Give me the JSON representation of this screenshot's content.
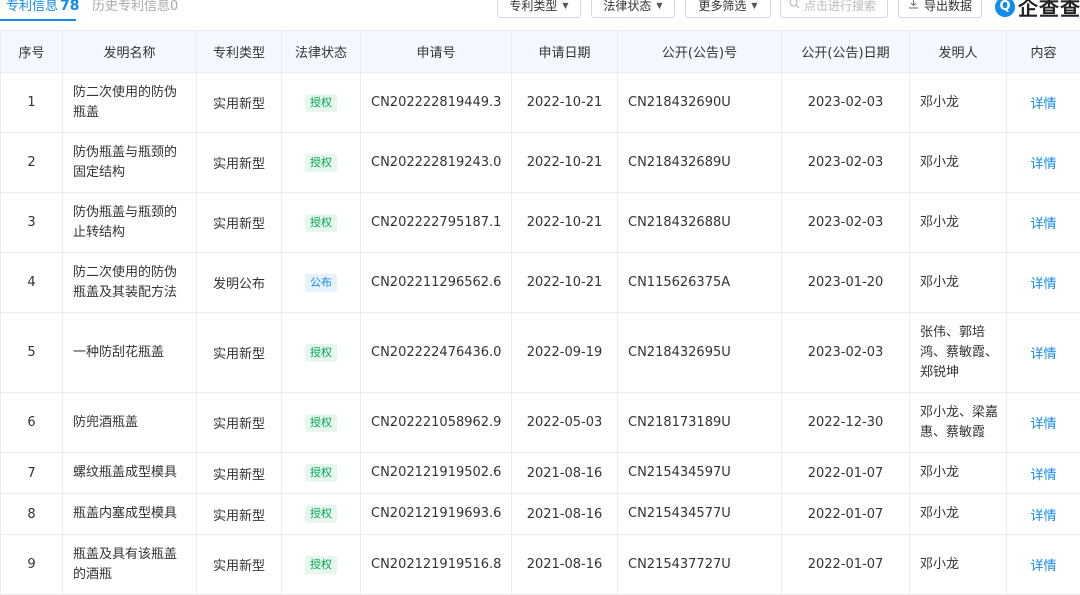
{
  "tabs": {
    "active_label": "专利信息",
    "active_count": "78",
    "inactive_label": "历史专利信息",
    "inactive_count": "0"
  },
  "filters": {
    "patent_type": "专利类型",
    "legal_status": "法律状态",
    "more_filters": "更多筛选",
    "search_placeholder": "点击进行搜索",
    "export": "导出数据"
  },
  "brand": {
    "mark": "Q",
    "name": "企查查"
  },
  "colors": {
    "accent": "#128bed",
    "granted": "#00a854",
    "header_bg": "#f2f8fe"
  },
  "table": {
    "headers": [
      "序号",
      "发明名称",
      "专利类型",
      "法律状态",
      "申请号",
      "申请日期",
      "公开(公告)号",
      "公开(公告)日期",
      "发明人",
      "内容"
    ],
    "rows": [
      {
        "no": "1",
        "name": "防二次使用的防伪瓶盖",
        "type": "实用新型",
        "status": "授权",
        "status_kind": "granted",
        "app_no": "CN202222819449.3",
        "app_date": "2022-10-21",
        "pub_no": "CN218432690U",
        "pub_date": "2023-02-03",
        "inventor": "邓小龙",
        "action": "详情"
      },
      {
        "no": "2",
        "name": "防伪瓶盖与瓶颈的固定结构",
        "type": "实用新型",
        "status": "授权",
        "status_kind": "granted",
        "app_no": "CN202222819243.0",
        "app_date": "2022-10-21",
        "pub_no": "CN218432689U",
        "pub_date": "2023-02-03",
        "inventor": "邓小龙",
        "action": "详情"
      },
      {
        "no": "3",
        "name": "防伪瓶盖与瓶颈的止转结构",
        "type": "实用新型",
        "status": "授权",
        "status_kind": "granted",
        "app_no": "CN202222795187.1",
        "app_date": "2022-10-21",
        "pub_no": "CN218432688U",
        "pub_date": "2023-02-03",
        "inventor": "邓小龙",
        "action": "详情"
      },
      {
        "no": "4",
        "name": "防二次使用的防伪瓶盖及其装配方法",
        "type": "发明公布",
        "status": "公布",
        "status_kind": "published",
        "app_no": "CN202211296562.6",
        "app_date": "2022-10-21",
        "pub_no": "CN115626375A",
        "pub_date": "2023-01-20",
        "inventor": "邓小龙",
        "action": "详情"
      },
      {
        "no": "5",
        "name": "一种防刮花瓶盖",
        "type": "实用新型",
        "status": "授权",
        "status_kind": "granted",
        "app_no": "CN202222476436.0",
        "app_date": "2022-09-19",
        "pub_no": "CN218432695U",
        "pub_date": "2023-02-03",
        "inventor": "张伟、郭培鸿、蔡敏霞、郑锐坤",
        "action": "详情"
      },
      {
        "no": "6",
        "name": "防兜酒瓶盖",
        "type": "实用新型",
        "status": "授权",
        "status_kind": "granted",
        "app_no": "CN202221058962.9",
        "app_date": "2022-05-03",
        "pub_no": "CN218173189U",
        "pub_date": "2022-12-30",
        "inventor": "邓小龙、梁嘉惠、蔡敏霞",
        "action": "详情"
      },
      {
        "no": "7",
        "name": "螺纹瓶盖成型模具",
        "type": "实用新型",
        "status": "授权",
        "status_kind": "granted",
        "app_no": "CN202121919502.6",
        "app_date": "2021-08-16",
        "pub_no": "CN215434597U",
        "pub_date": "2022-01-07",
        "inventor": "邓小龙",
        "action": "详情"
      },
      {
        "no": "8",
        "name": "瓶盖内塞成型模具",
        "type": "实用新型",
        "status": "授权",
        "status_kind": "granted",
        "app_no": "CN202121919693.6",
        "app_date": "2021-08-16",
        "pub_no": "CN215434577U",
        "pub_date": "2022-01-07",
        "inventor": "邓小龙",
        "action": "详情"
      },
      {
        "no": "9",
        "name": "瓶盖及具有该瓶盖的酒瓶",
        "type": "实用新型",
        "status": "授权",
        "status_kind": "granted",
        "app_no": "CN202121919516.8",
        "app_date": "2021-08-16",
        "pub_no": "CN215437727U",
        "pub_date": "2022-01-07",
        "inventor": "邓小龙",
        "action": "详情"
      }
    ]
  }
}
